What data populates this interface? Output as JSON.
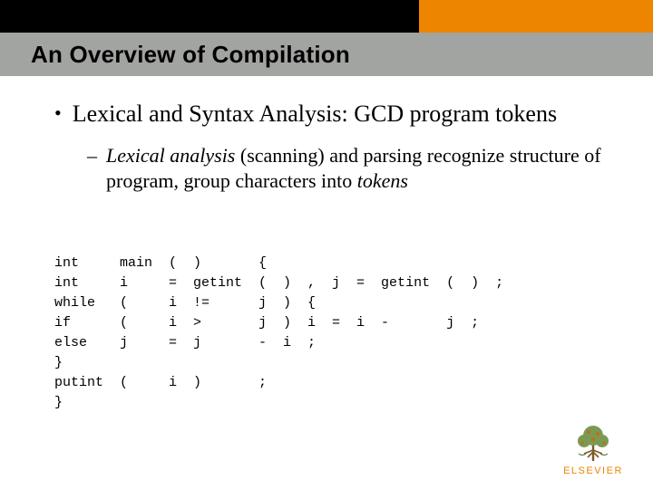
{
  "header": {
    "title": "An Overview of Compilation"
  },
  "bullet": {
    "marker": "•",
    "text_pre": "Lexical and Syntax Analysis",
    "text_post": ": GCD program tokens"
  },
  "subbullet": {
    "marker": "–",
    "text_a": "Lexical analysis",
    "text_b": " (scanning) and parsing recognize structure of program, group characters into ",
    "text_c": "tokens"
  },
  "tokens": {
    "col0": [
      "int",
      "int",
      "while",
      "if",
      "else",
      "}",
      "putint",
      "}"
    ],
    "col1": [
      "main",
      "i",
      "(",
      "(",
      "j",
      "",
      "(",
      ""
    ],
    "col2": [
      "(",
      "=",
      "i",
      "i",
      "=",
      "",
      "i",
      ""
    ],
    "col3": [
      ")",
      "getint",
      "!=",
      ">",
      "j",
      "",
      ")",
      ""
    ],
    "col4": [
      "{",
      "(",
      "j",
      "j",
      "-",
      "",
      ";",
      ""
    ],
    "col5": [
      "",
      ")",
      ")",
      ")",
      "i",
      "",
      "",
      ""
    ],
    "col6": [
      "",
      ",",
      "{",
      "i",
      ";",
      "",
      "",
      ""
    ],
    "col7": [
      "",
      "j",
      "",
      "=",
      "",
      "",
      "",
      ""
    ],
    "col8": [
      "",
      "=",
      "",
      "i",
      "",
      "",
      "",
      ""
    ],
    "col9": [
      "",
      "getint",
      "",
      "-",
      "",
      "",
      "",
      ""
    ],
    "col10": [
      "",
      "(",
      "",
      "j",
      "",
      "",
      "",
      ""
    ],
    "col11": [
      "",
      ")",
      "",
      ";",
      "",
      "",
      "",
      ""
    ],
    "col12": [
      "",
      ";",
      "",
      "",
      "",
      "",
      "",
      ""
    ]
  },
  "logo": {
    "text": "ELSEVIER"
  },
  "colors": {
    "orange": "#ee8500",
    "gray": "#a2a4a1",
    "black": "#000000"
  }
}
